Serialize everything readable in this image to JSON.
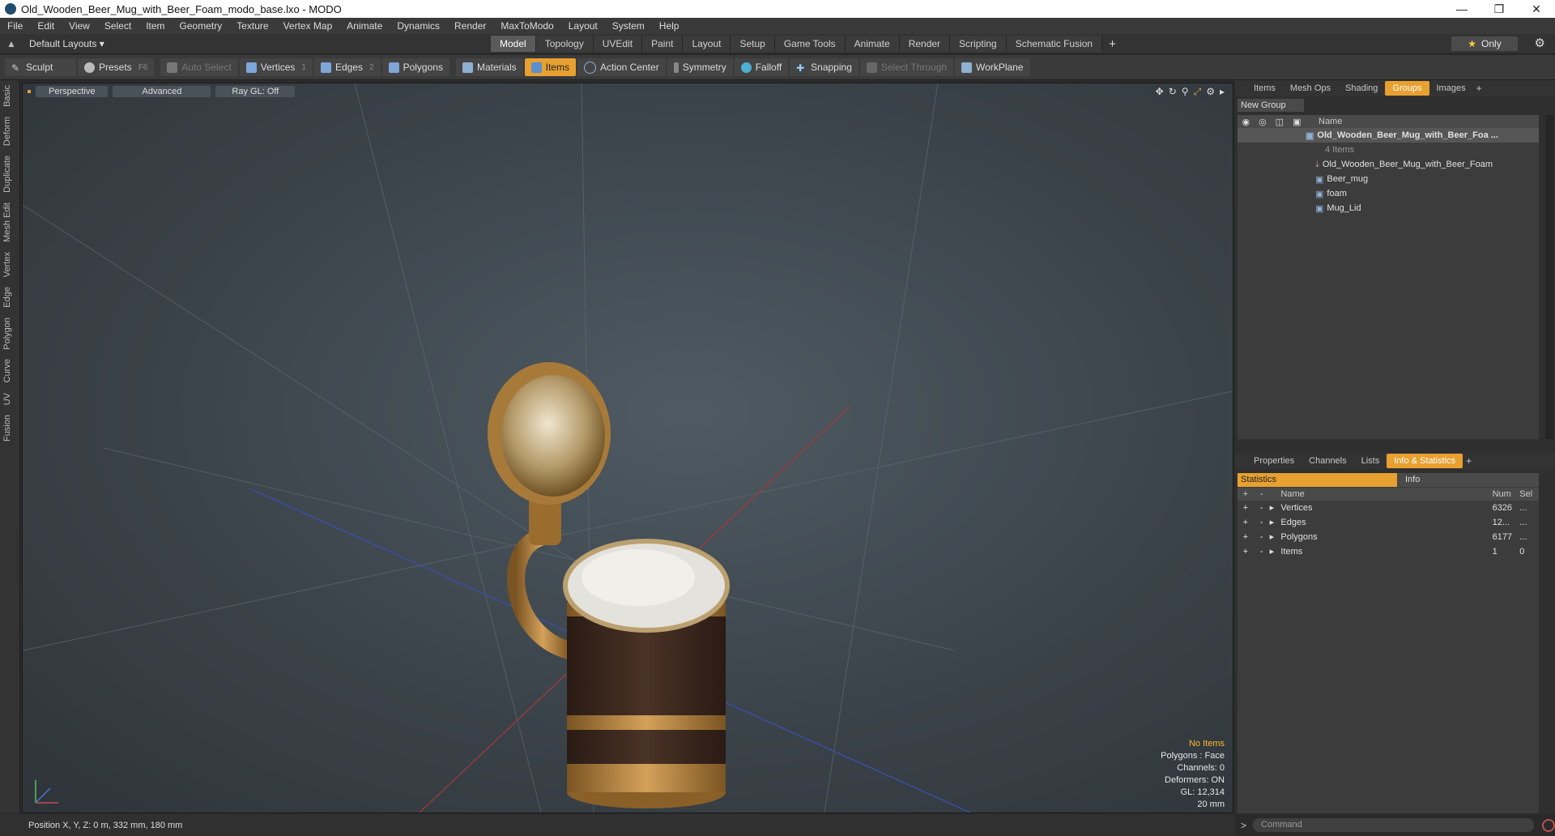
{
  "window": {
    "title": "Old_Wooden_Beer_Mug_with_Beer_Foam_modo_base.lxo - MODO"
  },
  "menu": [
    "File",
    "Edit",
    "View",
    "Select",
    "Item",
    "Geometry",
    "Texture",
    "Vertex Map",
    "Animate",
    "Dynamics",
    "Render",
    "MaxToModo",
    "Layout",
    "System",
    "Help"
  ],
  "layout": {
    "current": "Default Layouts ▾",
    "tabs": [
      "Model",
      "Topology",
      "UVEdit",
      "Paint",
      "Layout",
      "Setup",
      "Game Tools",
      "Animate",
      "Render",
      "Scripting",
      "Schematic Fusion"
    ],
    "active_tab": "Model",
    "only_label": "Only"
  },
  "toolbar": {
    "sculpt": "Sculpt",
    "presets": "Presets",
    "presets_key": "F6",
    "auto_select": "Auto Select",
    "vertices": "Vertices",
    "vertices_key": "1",
    "edges": "Edges",
    "edges_key": "2",
    "polygons": "Polygons",
    "materials": "Materials",
    "items": "Items",
    "action_center": "Action Center",
    "symmetry": "Symmetry",
    "falloff": "Falloff",
    "snapping": "Snapping",
    "select_through": "Select Through",
    "workplane": "WorkPlane"
  },
  "left_tabs": [
    "Basic",
    "Deform",
    "Duplicate",
    "Mesh Edit",
    "Vertex",
    "Edge",
    "Polygon",
    "Curve",
    "UV",
    "Fusion"
  ],
  "viewport": {
    "perspective": "Perspective",
    "advanced": "Advanced",
    "raygl": "Ray GL: Off",
    "hud": {
      "no_items": "No Items",
      "polygons": "Polygons : Face",
      "channels": "Channels: 0",
      "deformers": "Deformers: ON",
      "gl": "GL: 12,314",
      "scale": "20 mm"
    }
  },
  "status": {
    "position": "Position X, Y, Z:  0 m, 332 mm, 180 mm"
  },
  "groups_panel": {
    "tabs": [
      "Items",
      "Mesh Ops",
      "Shading",
      "Groups",
      "Images"
    ],
    "active": "Groups",
    "new_group": "New Group",
    "name_col": "Name",
    "root": "Old_Wooden_Beer_Mug_with_Beer_Foa ...",
    "root_sub": "4 Items",
    "children": [
      "Old_Wooden_Beer_Mug_with_Beer_Foam",
      "Beer_mug",
      "foam",
      "Mug_Lid"
    ]
  },
  "info_panel": {
    "tabs": [
      "Properties",
      "Channels",
      "Lists",
      "Info & Statistics"
    ],
    "active": "Info & Statistics",
    "sub_tabs": [
      "Statistics",
      "Info"
    ],
    "headers": {
      "name": "Name",
      "num": "Num",
      "sel": "Sel"
    },
    "rows": [
      {
        "name": "Vertices",
        "num": "6326",
        "sel": "..."
      },
      {
        "name": "Edges",
        "num": "12...",
        "sel": "..."
      },
      {
        "name": "Polygons",
        "num": "6177",
        "sel": "..."
      },
      {
        "name": "Items",
        "num": "1",
        "sel": "0"
      }
    ]
  },
  "command": {
    "placeholder": "Command"
  },
  "colors": {
    "accent": "#e8a030",
    "viewport": "#3b434a"
  }
}
